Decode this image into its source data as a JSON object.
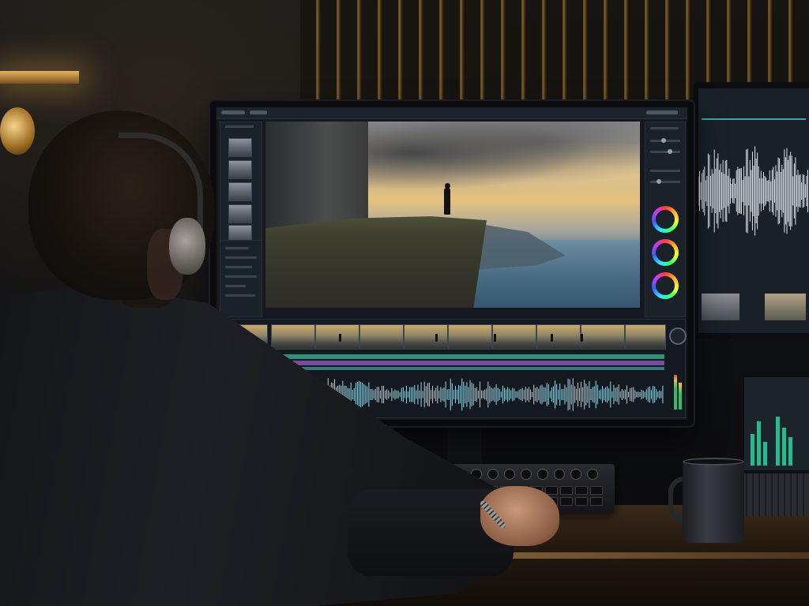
{
  "scene": {
    "description_colors": {
      "timeline_green": "#2f8f77",
      "timeline_purple": "#7b4a9c",
      "waveform": "#9fd8e6",
      "accent_warm": "#e6b45d"
    },
    "icons": {
      "headphones": "headphones-icon",
      "color_wheel": "color-wheel-icon",
      "coffee_mug": "coffee-mug-icon"
    }
  }
}
